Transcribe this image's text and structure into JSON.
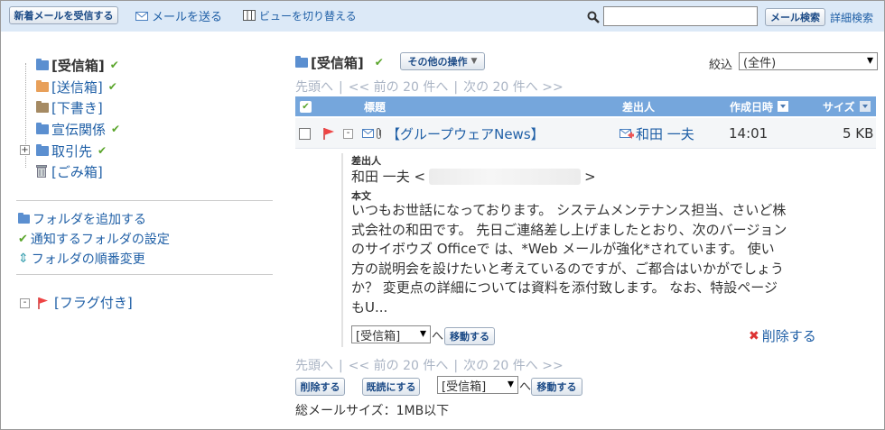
{
  "toolbar": {
    "receive_label": "新着メールを受信する",
    "send_label": "メールを送る",
    "view_label": "ビューを切り替える",
    "search_value": "",
    "search_button": "メール検索",
    "advanced_search": "詳細検索"
  },
  "sidebar": {
    "folders": [
      {
        "label": "[受信箱]",
        "color": "#5b8fd0"
      },
      {
        "label": "[送信箱]",
        "color": "#e8a05a"
      },
      {
        "label": "[下書き]",
        "color": "#a58a63"
      },
      {
        "label": "宣伝関係",
        "color": "#5b8fd0"
      },
      {
        "label": "取引先",
        "color": "#5b8fd0"
      },
      {
        "label": "[ごみ箱]"
      }
    ],
    "add_folder": "フォルダを追加する",
    "notify_settings": "通知するフォルダの設定",
    "reorder": "フォルダの順番変更",
    "flagged": "[フラグ付き]"
  },
  "main": {
    "folder_title": "[受信箱]",
    "other_ops": "その他の操作",
    "filter_label": "絞込",
    "filter_value": "(全件)",
    "pager": {
      "first": "先頭へ",
      "sep": "|",
      "prev": "<< 前の 20 件へ",
      "next": "次の 20 件へ >>"
    },
    "columns": {
      "subject": "標題",
      "sender": "差出人",
      "date": "作成日時",
      "size": "サイズ"
    },
    "message": {
      "subject": "【グループウェアNews】",
      "sender": "和田 一夫",
      "time": "14:01",
      "size": "5 KB"
    },
    "preview": {
      "sender_heading": "差出人",
      "sender_name": "和田 一夫 <",
      "sender_end": ">",
      "body_heading": "本文",
      "body_lines": [
        "いつもお世話になっております。 システムメンテナンス担当、さいど株",
        "式会社の和田です。 先日ご連絡差し上げましたとおり、次のバージョン",
        "のサイボウズ Officeで は、*Web メールが強化*されています。 使い",
        "方の説明会を設けたいと考えているのですが、ご都合はいかがでしょう",
        "か？ 変更点の詳細については資料を添付致します。 なお、特設ページ",
        "もU..."
      ],
      "move_select": "[受信箱]",
      "to": "へ",
      "move_button": "移動する",
      "delete_link": "削除する"
    },
    "actions": {
      "delete_button": "削除する",
      "mark_read_button": "既読にする",
      "move_select": "[受信箱]",
      "to": "へ",
      "move_button": "移動する"
    },
    "total_size": "総メールサイズ：1MB以下"
  }
}
